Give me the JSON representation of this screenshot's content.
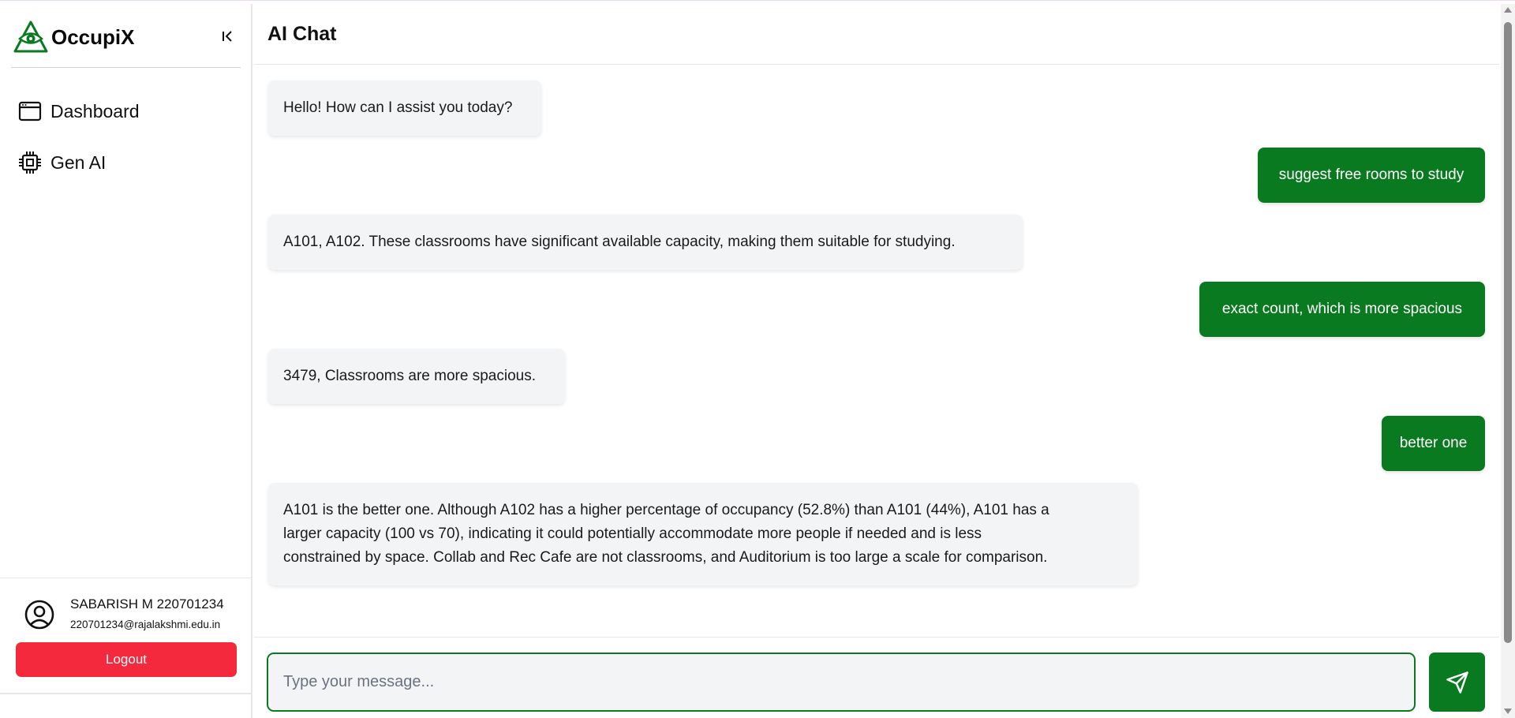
{
  "brand": {
    "name": "OccupiX",
    "logo_icon": "eye-triangle-icon",
    "accent": "#0a7a20"
  },
  "sidebar": {
    "collapse_icon": "collapse-left-icon",
    "items": [
      {
        "label": "Dashboard",
        "icon": "browser-window-icon"
      },
      {
        "label": "Gen AI",
        "icon": "cpu-chip-icon"
      }
    ]
  },
  "profile": {
    "name": "SABARISH M 220701234",
    "email": "220701234@rajalakshmi.edu.in",
    "avatar_icon": "user-circle-icon",
    "logout_label": "Logout",
    "logout_color": "#f5293d"
  },
  "chat": {
    "title": "AI Chat",
    "messages": [
      {
        "role": "assistant",
        "text": "Hello! How can I assist you today?"
      },
      {
        "role": "user",
        "text": "suggest free rooms to study"
      },
      {
        "role": "assistant",
        "text": "A101, A102. These classrooms have significant available capacity, making them suitable for studying."
      },
      {
        "role": "user",
        "text": "exact count, which is more spacious"
      },
      {
        "role": "assistant",
        "text": "3479, Classrooms are more spacious."
      },
      {
        "role": "user",
        "text": "better one"
      },
      {
        "role": "assistant",
        "lines": [
          "A101 is the better one. Although A102 has a higher percentage of occupancy (52.8%) than A101 (44%), A101 has a",
          "larger capacity (100 vs 70), indicating it could potentially accommodate more people if needed and is less",
          "constrained by space. Collab and Rec Cafe are not classrooms, and Auditorium is too large a scale for comparison."
        ]
      }
    ],
    "input": {
      "value": "",
      "placeholder": "Type your message..."
    },
    "send_icon": "send-paper-plane-icon"
  }
}
